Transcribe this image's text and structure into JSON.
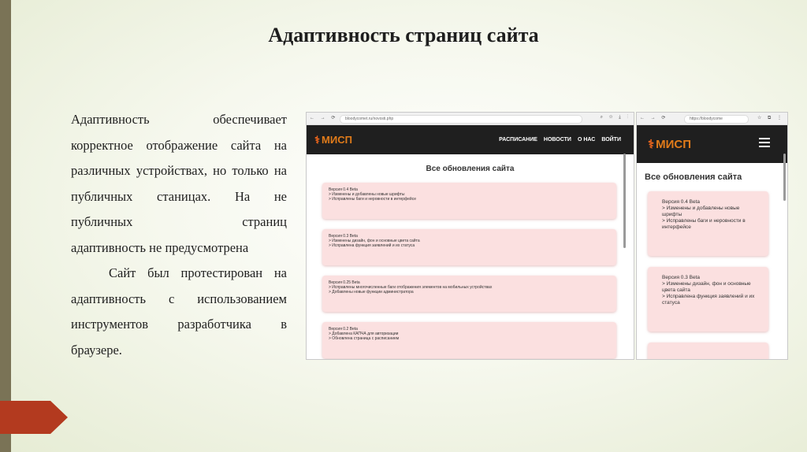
{
  "slide": {
    "title": "Адаптивность страниц сайта",
    "paragraphs": [
      "Адаптивность обеспечивает корректное отображение сайта на различных устройствах, но только на публичных станицах. На не публичных страниц",
      "адаптивность не предусмотрена",
      "Сайт был протестирован на адаптивность с использованием инструментов разработчика в",
      "браузере."
    ]
  },
  "desktop": {
    "url": "bloodycomet.ru/novosti.php",
    "nav_icons": "← → ⟳",
    "tool_icons": "⌕ ☆ ⤓ ⋮",
    "logo": "МИСП",
    "menu": [
      "РАСПИСАНИЕ",
      "НОВОСТИ",
      "О НАС",
      "ВОЙТИ"
    ],
    "heading": "Все обновления сайта",
    "cards": [
      {
        "title": "Версия 0.4 Beta",
        "lines": [
          "> Изменены и добавлены новые шрифты",
          "> Исправлены баги и неровности в интерфейсе"
        ]
      },
      {
        "title": "Версия 0.3 Beta",
        "lines": [
          "> Изменены дизайн, фон и основные цвета сайта",
          "> Исправлена функция заявлений и их статуса"
        ]
      },
      {
        "title": "Версия 0.25 Beta",
        "lines": [
          "> Исправлены многочисленные баги отображения элементов на мобильных устройствах",
          "> Добавлены новые функции администратора"
        ]
      },
      {
        "title": "Версия 0.2 Beta",
        "lines": [
          "> Добавлена КАПЧА для авторизации",
          "> Обновлена страница с расписанием"
        ]
      }
    ]
  },
  "mobile": {
    "url": "https://bloodycome",
    "nav_icons": "← → ⟳",
    "tool_icons": "☆ ⧉ ⋮",
    "logo": "МИСП",
    "heading": "Все обновления сайта",
    "cards": [
      {
        "title": "Версия 0.4 Beta",
        "lines": [
          "> Изменены и добавлены новые шрифты",
          "> Исправлены баги и неровности в интерфейсе"
        ]
      },
      {
        "title": "Версия 0.3 Beta",
        "lines": [
          "> Изменены дизайн, фон и основные цвета сайта",
          "> Исправлена функция заявлений и их статуса"
        ]
      },
      {
        "title": "",
        "lines": []
      }
    ]
  },
  "colors": {
    "accent": "#b33a1f",
    "left_bar": "#7a7356",
    "card": "#fbe0e0",
    "logo": "#e07b1a"
  }
}
